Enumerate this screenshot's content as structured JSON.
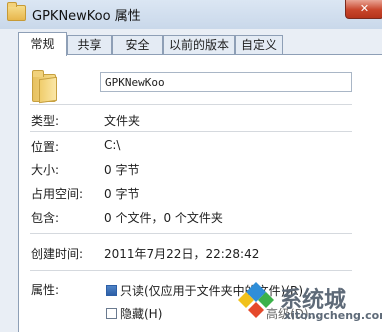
{
  "window": {
    "title": "GPKNewKoo 属性",
    "close_glyph": "✕"
  },
  "tabs": [
    {
      "label": "常规",
      "active": true
    },
    {
      "label": "共享",
      "active": false
    },
    {
      "label": "安全",
      "active": false
    },
    {
      "label": "以前的版本",
      "active": false
    },
    {
      "label": "自定义",
      "active": false
    }
  ],
  "general": {
    "folder_name": "GPKNewKoo",
    "rows": [
      {
        "label": "类型:",
        "value": "文件夹"
      },
      {
        "label": "位置:",
        "value": "C:\\"
      },
      {
        "label": "大小:",
        "value": "0 字节"
      },
      {
        "label": "占用空间:",
        "value": "0 字节"
      },
      {
        "label": "包含:",
        "value": "0 个文件，0 个文件夹"
      }
    ],
    "created": {
      "label": "创建时间:",
      "value": "2011年7月22日，22:28:42"
    },
    "attributes": {
      "label": "属性:",
      "readonly": {
        "label": "只读(仅应用于文件夹中的文件)(R)",
        "checked": true
      },
      "hidden": {
        "label": "隐藏(H)",
        "checked": false
      },
      "advanced_label": "高级(D)..."
    }
  },
  "watermark": {
    "brand": "系统城",
    "url": "xitongcheng.com"
  },
  "colors": {
    "accent": "#2d5fa6",
    "close": "#c8452b"
  }
}
